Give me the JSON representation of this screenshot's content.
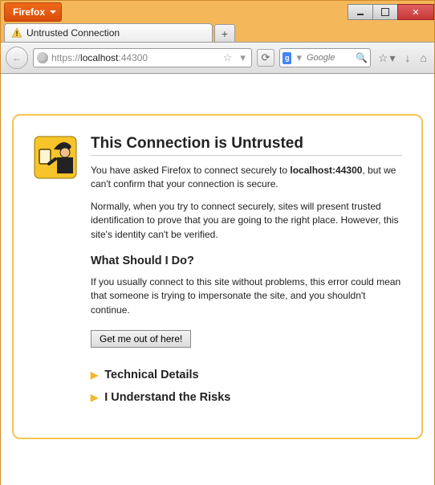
{
  "app": {
    "name": "Firefox"
  },
  "tab": {
    "title": "Untrusted Connection"
  },
  "newtab": {
    "label": "+"
  },
  "url": {
    "prefix": "https://",
    "host": "localhost",
    "port": ":44300"
  },
  "search": {
    "placeholder": "Google",
    "engine_glyph": "g"
  },
  "toolbar_icons": {
    "back": "←",
    "reload": "⟳",
    "star": "☆",
    "dropdown": "▾",
    "download": "↓",
    "home": "⌂",
    "magnifier": "🔍"
  },
  "winbtn": {
    "close": "✕"
  },
  "page": {
    "heading": "This Connection is Untrusted",
    "p1a": "You have asked Firefox to connect securely to ",
    "p1host": "localhost:44300",
    "p1b": ", but we can't confirm that your connection is secure.",
    "p2": "Normally, when you try to connect securely, sites will present trusted identification to prove that you are going to the right place. However, this site's identity can't be verified.",
    "h2": "What Should I Do?",
    "p3": "If you usually connect to this site without problems, this error could mean that someone is trying to impersonate the site, and you shouldn't continue.",
    "getout": "Get me out of here!",
    "exp1": "Technical Details",
    "exp2": "I Understand the Risks",
    "triangle": "▶"
  }
}
